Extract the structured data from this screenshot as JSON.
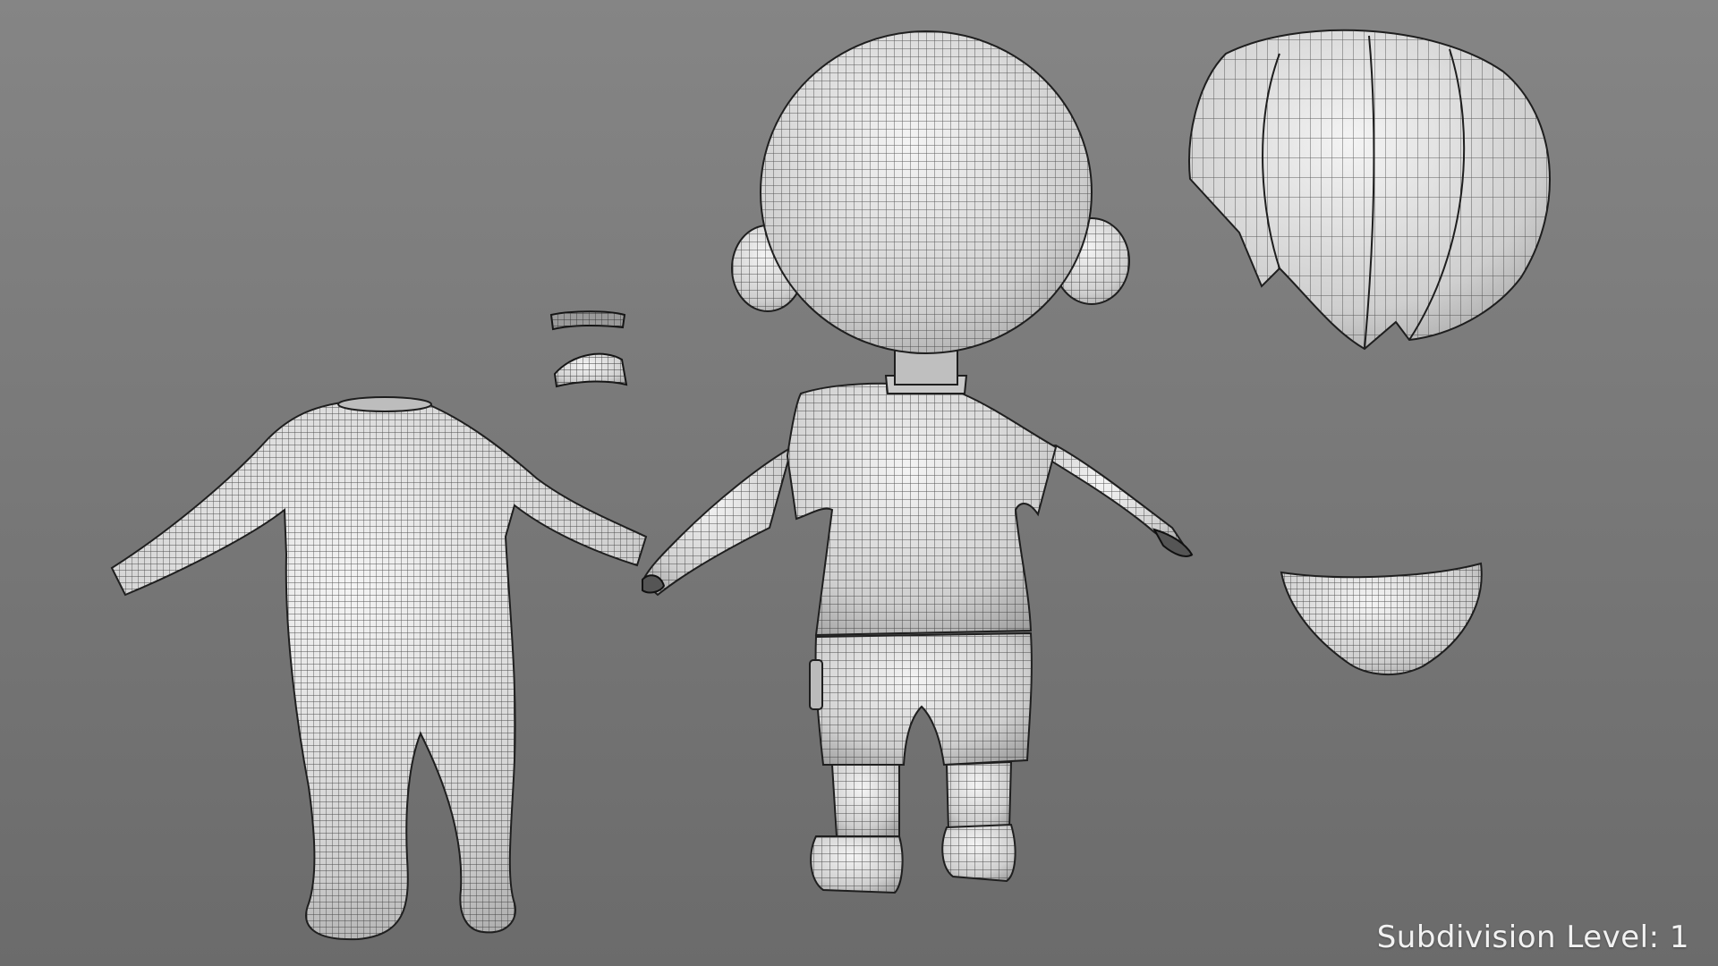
{
  "viewport": {
    "subdivision_label": "Subdivision Level: 1",
    "background_top": "#808080",
    "background_bottom": "#6d6d6d",
    "mesh_fill": "#d9d9d9",
    "wire_color": "#2b2b2b"
  },
  "objects": [
    {
      "name": "bodysuit",
      "icon": "mesh"
    },
    {
      "name": "eyelashes",
      "icon": "mesh"
    },
    {
      "name": "eyebrow",
      "icon": "mesh"
    },
    {
      "name": "character-body",
      "icon": "mesh"
    },
    {
      "name": "hair",
      "icon": "mesh"
    },
    {
      "name": "underwear",
      "icon": "mesh"
    }
  ]
}
